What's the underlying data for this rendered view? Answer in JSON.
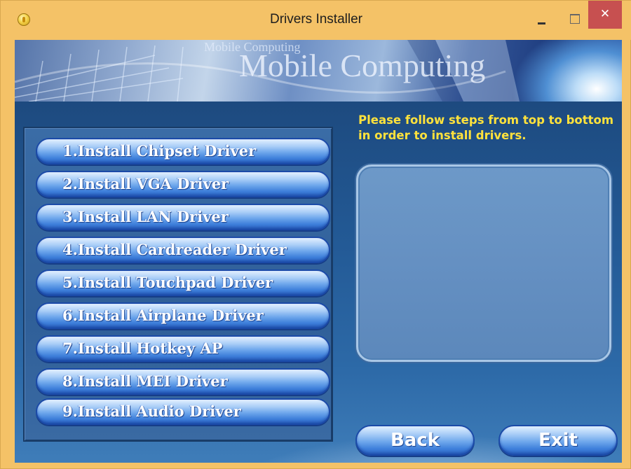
{
  "window": {
    "title": "Drivers Installer",
    "minimize_glyph": "",
    "maximize_glyph": "",
    "close_glyph": "✕"
  },
  "banner": {
    "small_text": "Mobile Computing",
    "logo_text": "Mobile Computing"
  },
  "instructions": "Please follow steps from top to bottom in order to install drivers.",
  "drivers": [
    {
      "label": "1.Install Chipset Driver"
    },
    {
      "label": "2.Install VGA Driver"
    },
    {
      "label": "3.Install LAN Driver"
    },
    {
      "label": "4.Install Cardreader Driver"
    },
    {
      "label": "5.Install Touchpad Driver"
    },
    {
      "label": "6.Install Airplane Driver"
    },
    {
      "label": "7.Install Hotkey AP"
    },
    {
      "label": "8.Install MEI Driver"
    },
    {
      "label": "9.Install Audio Driver"
    }
  ],
  "nav": {
    "back_label": "Back",
    "exit_label": "Exit"
  },
  "colors": {
    "titlebar": "#f4c267",
    "close_button": "#c75050",
    "panel_background": "#235a96",
    "instruction_text": "#ffe23c",
    "button_border": "#1b4aa8"
  },
  "icons": {
    "app": "installer-disc-icon",
    "minimize": "minimize-icon",
    "maximize": "maximize-icon",
    "close": "close-icon"
  }
}
